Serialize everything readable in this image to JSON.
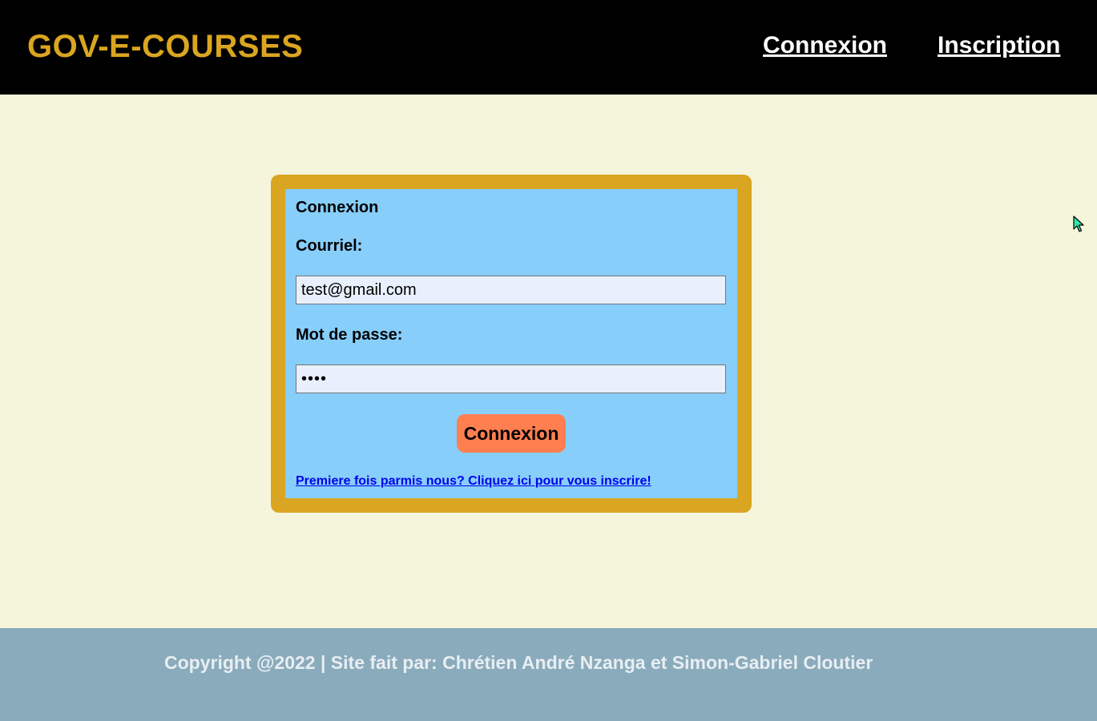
{
  "header": {
    "brand": "GOV-E-COURSES",
    "nav": {
      "login": "Connexion",
      "register": "Inscription"
    }
  },
  "login_form": {
    "title": "Connexion",
    "email_label": "Courriel:",
    "email_value": "test@gmail.com",
    "password_label": "Mot de passe:",
    "password_value": "test",
    "submit_label": "Connexion",
    "signup_link": "Premiere fois parmis nous? Cliquez ici pour vous inscrire!"
  },
  "footer": {
    "copyright": "Copyright @2022 | Site fait par: Chrétien André Nzanga et Simon-Gabriel Cloutier"
  },
  "colors": {
    "header_bg": "#000000",
    "brand": "#daa520",
    "page_bg": "#f5f5dc",
    "card_border": "#daa520",
    "card_bg": "#87cefa",
    "input_bg": "#e8f0fe",
    "button_bg": "#ff7f50",
    "link": "#0000ee",
    "footer_bg": "#8aabbc",
    "footer_text": "#e8eef2"
  },
  "icons": {
    "cursor": "mouse-pointer-icon"
  }
}
